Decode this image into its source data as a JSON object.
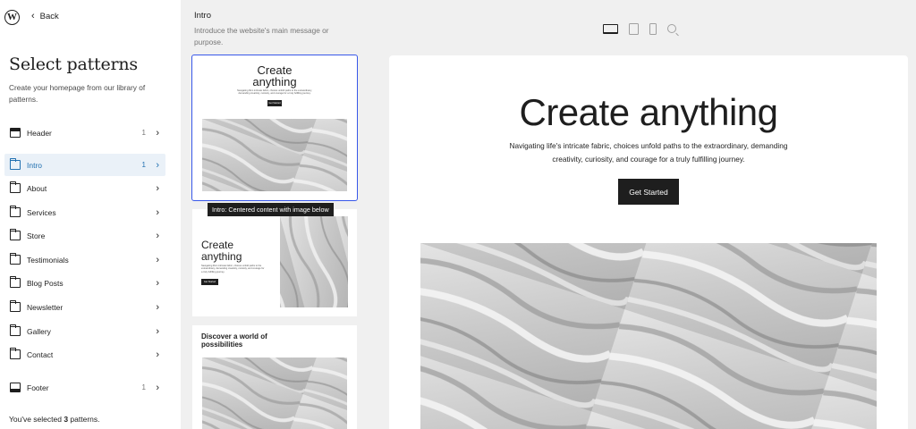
{
  "app": {
    "back_label": "Back",
    "page_title": "Select patterns",
    "page_subtitle": "Create your homepage from our library of patterns.",
    "selected_prefix": "You've selected ",
    "selected_count": "3",
    "selected_suffix": " patterns."
  },
  "nav": {
    "header": {
      "label": "Header",
      "count": "1"
    },
    "intro": {
      "label": "Intro",
      "count": "1"
    },
    "about": {
      "label": "About"
    },
    "services": {
      "label": "Services"
    },
    "store": {
      "label": "Store"
    },
    "testimonials": {
      "label": "Testimonials"
    },
    "blog_posts": {
      "label": "Blog Posts"
    },
    "newsletter": {
      "label": "Newsletter"
    },
    "gallery": {
      "label": "Gallery"
    },
    "contact": {
      "label": "Contact"
    },
    "footer": {
      "label": "Footer",
      "count": "1"
    }
  },
  "patterns_panel": {
    "category_title": "Intro",
    "category_description": "Introduce the website's main message or purpose.",
    "tooltip": "Intro: Centered content with image below",
    "card1": {
      "heading": "Create anything",
      "body": "Navigating life's intricate fabric, choices unfold paths to the extraordinary, demanding creativity, curiosity, and courage for a truly fulfilling journey.",
      "button": "Get Started"
    },
    "card2": {
      "heading": "Create anything",
      "body": "Navigating life's intricate fabric, choices unfold paths to the extraordinary, demanding creativity, curiosity, and courage for a truly fulfilling journey.",
      "button": "Get Started"
    },
    "card3": {
      "heading": "Discover a world of possibilities"
    }
  },
  "preview": {
    "device_icons": [
      "desktop-icon",
      "tablet-icon",
      "mobile-icon",
      "zoom-out-icon"
    ],
    "hero_title": "Create anything",
    "hero_text": "Navigating life's intricate fabric, choices unfold paths to the extraordinary, demanding creativity, curiosity, and courage for a truly fulfilling journey.",
    "hero_button": "Get Started"
  },
  "colors": {
    "accent": "#2271b1",
    "selection_outline": "#3858e9",
    "panel_bg": "#f0f0f0",
    "active_nav_bg": "#eaf1f8"
  }
}
